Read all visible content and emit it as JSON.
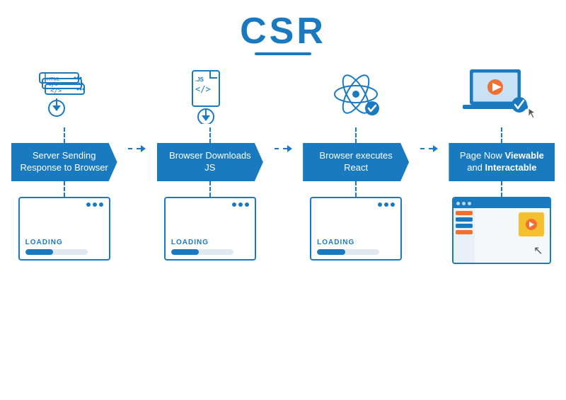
{
  "title": "CSR",
  "steps": [
    {
      "id": "step1",
      "icon_type": "html_server",
      "banner_text": "Server Sending Response to Browser",
      "banner_bold": "",
      "bottom_type": "loading"
    },
    {
      "id": "step2",
      "icon_type": "js_file",
      "banner_text": "Browser Downloads JS",
      "banner_bold": "",
      "bottom_type": "loading"
    },
    {
      "id": "step3",
      "icon_type": "react_atom",
      "banner_text": "Browser executes React",
      "banner_bold": "",
      "bottom_type": "loading"
    },
    {
      "id": "step4",
      "icon_type": "laptop",
      "banner_text_pre": "Page Now ",
      "banner_text_bold1": "Viewable",
      "banner_text_mid": " and ",
      "banner_text_bold2": "Interactable",
      "bottom_type": "browser"
    }
  ],
  "loading_label": "LOADING"
}
